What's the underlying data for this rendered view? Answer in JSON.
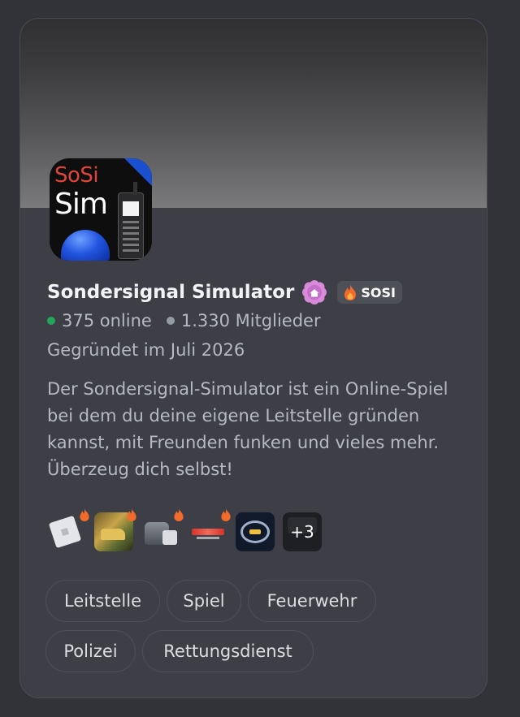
{
  "server": {
    "name": "Sondersignal Simulator",
    "logo_text_line1": "SoSi",
    "logo_text_line2": "Sim",
    "badge_icon": "flower-badge-icon",
    "tag": {
      "icon": "flame-icon",
      "label": "SOSI"
    },
    "online": "375 online",
    "members": "1.330 Mitglieder",
    "founded": "Gegründet im Juli 2026",
    "description": "Der Sondersignal-Simulator ist ein Online-Spiel bei dem du deine eigene Leitstelle gründen kannst, mit Freunden funken und vieles mehr. Überzeug dich selbst!"
  },
  "games": [
    {
      "icon": "roblox-game-icon",
      "hot": true
    },
    {
      "icon": "rally-car-game-icon",
      "hot": true
    },
    {
      "icon": "truck-sim-game-icon",
      "hot": true
    },
    {
      "icon": "racing-game-icon",
      "hot": true
    },
    {
      "icon": "emblem-game-icon",
      "hot": false
    }
  ],
  "games_more": "+3",
  "tags": [
    "Leitstelle",
    "Spiel",
    "Feuerwehr",
    "Polizei",
    "Rettungsdienst"
  ],
  "colors": {
    "background": "#313338",
    "card": "#3d3e46",
    "online_dot": "#23a55a",
    "members_dot": "#949ba4",
    "text_primary": "#f2f3f5",
    "text_muted": "#b5bac1"
  }
}
